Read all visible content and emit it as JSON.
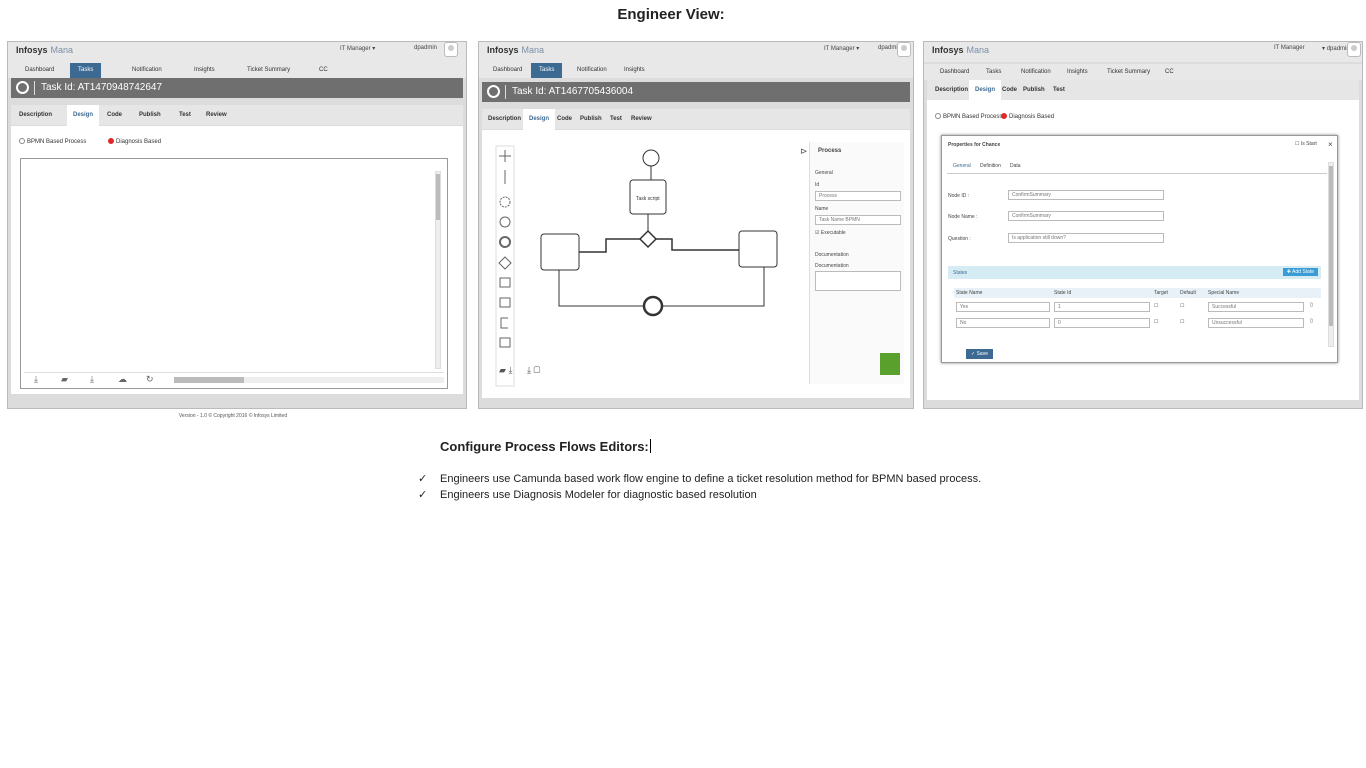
{
  "page_title": "Engineer View:",
  "panels": [
    {
      "brand_logo": "Infosys",
      "brand_product": "Mana",
      "role": "IT Manager",
      "user": "dpadmin",
      "nav": [
        "Dashboard",
        "Tasks",
        "Notification",
        "Insights",
        "Ticket Summary",
        "CC"
      ],
      "task_id": "Task Id: AT1470948742647",
      "tabs": [
        "Description",
        "Design",
        "Code",
        "Publish",
        "Test",
        "Review"
      ],
      "radio_options": [
        "BPMN Based Process",
        "Diagnosis Based"
      ],
      "selected_radio": "Diagnosis Based",
      "footer": "Version - 1.0 © Copyright 2016 © Infosys Limited"
    },
    {
      "brand_logo": "Infosys",
      "brand_product": "Mana",
      "role": "IT Manager",
      "user": "dpadmin",
      "nav": [
        "Dashboard",
        "Tasks",
        "Notification",
        "Insights"
      ],
      "task_id": "Task Id: AT1467705436004",
      "tabs": [
        "Description",
        "Design",
        "Code",
        "Publish",
        "Test",
        "Review"
      ],
      "diagram_task_label": "Task script",
      "properties": {
        "title": "Process",
        "section_general": "General",
        "id_label": "Id",
        "id_value": "Process",
        "name_label": "Name",
        "name_value": "Task Name BPMN",
        "executable_label": "Executable",
        "section_doc": "Documentation",
        "doc_label": "Documentation"
      }
    },
    {
      "brand_logo": "Infosys",
      "brand_product": "Mana",
      "role": "IT Manager",
      "user": "dpadmin",
      "nav": [
        "Dashboard",
        "Tasks",
        "Notification",
        "Insights",
        "Ticket Summary",
        "CC"
      ],
      "tabs": [
        "Description",
        "Design",
        "Code",
        "Publish",
        "Test"
      ],
      "radio_options": [
        "BPMN Based Process",
        "Diagnosis Based"
      ],
      "selected_radio": "Diagnosis Based",
      "modal": {
        "title": "Properties for Chance",
        "start_label": "Is Start",
        "tabs": [
          "General",
          "Definition",
          "Data"
        ],
        "node_id_label": "Node ID :",
        "node_id_value": "ConfirmSummary",
        "node_name_label": "Node Name :",
        "node_name_value": "ConfirmSummary",
        "question_label": "Question :",
        "question_value": "Is application still down?",
        "states_title": "States",
        "add_state": "Add State",
        "columns": [
          "State Name",
          "State Id",
          "Target",
          "Default",
          "Special Name"
        ],
        "rows": [
          {
            "name": "Yes",
            "id": "1",
            "special": "Successful"
          },
          {
            "name": "No",
            "id": "0",
            "special": "Unsuccessful"
          }
        ],
        "save": "Save"
      }
    }
  ],
  "section_title": "Configure Process Flows Editors:",
  "bullets": [
    "Engineers use Camunda based work flow engine to define a ticket resolution method for BPMN based process.",
    "Engineers use Diagnosis Modeler for diagnostic based resolution"
  ],
  "check_mark": "✓"
}
